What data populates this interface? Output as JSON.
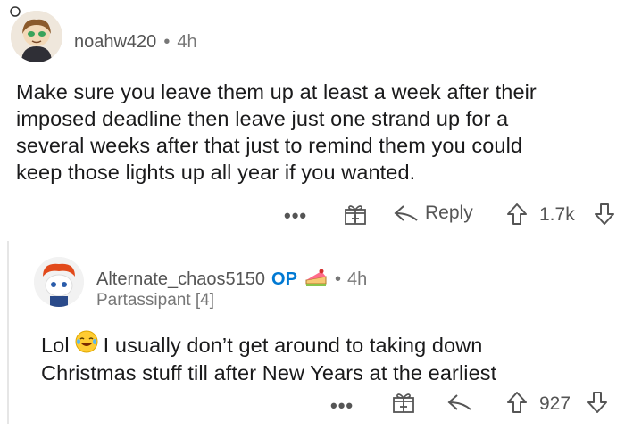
{
  "comment": {
    "username": "noahw420",
    "separator": "•",
    "time": "4h",
    "body_lines": [
      "Make sure you leave them up at least a week after their",
      "imposed deadline then leave just one strand up for a",
      "several weeks after that just to remind them you could",
      "keep those lights up all year if you wanted."
    ],
    "actions": {
      "more": "•••",
      "reply_label": "Reply",
      "score": "1.7k"
    }
  },
  "reply": {
    "username": "Alternate_chaos5150",
    "op_badge": "OP",
    "separator": "•",
    "time": "4h",
    "flair": "Partassipant [4]",
    "body_prefix": "Lol",
    "body_rest_line1": "I usually don’t get around to taking down",
    "body_line2": "Christmas stuff till after New Years at the earliest",
    "actions": {
      "more": "•••",
      "score": "927"
    }
  },
  "colors": {
    "op_blue": "#0079d3",
    "text": "#1a1a1b",
    "muted": "#777777"
  }
}
